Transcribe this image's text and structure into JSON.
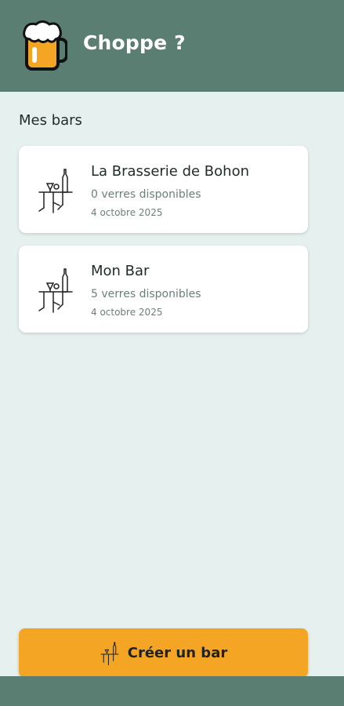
{
  "app": {
    "title": "Choppe ?",
    "logo_icon": "beer-mug-icon"
  },
  "section": {
    "title": "Mes bars"
  },
  "bars": [
    {
      "name": "La Brasserie de Bohon",
      "glasses": "0 verres disponibles",
      "date": "4 octobre 2025",
      "icon": "bar-counter-icon"
    },
    {
      "name": "Mon Bar",
      "glasses": "5 verres disponibles",
      "date": "4 octobre 2025",
      "icon": "bar-counter-icon"
    }
  ],
  "create_button": {
    "label": "Créer un bar",
    "icon": "bar-counter-icon"
  },
  "colors": {
    "header": "#5a7e72",
    "background": "#e6f0ee",
    "accent": "#f3a523"
  }
}
